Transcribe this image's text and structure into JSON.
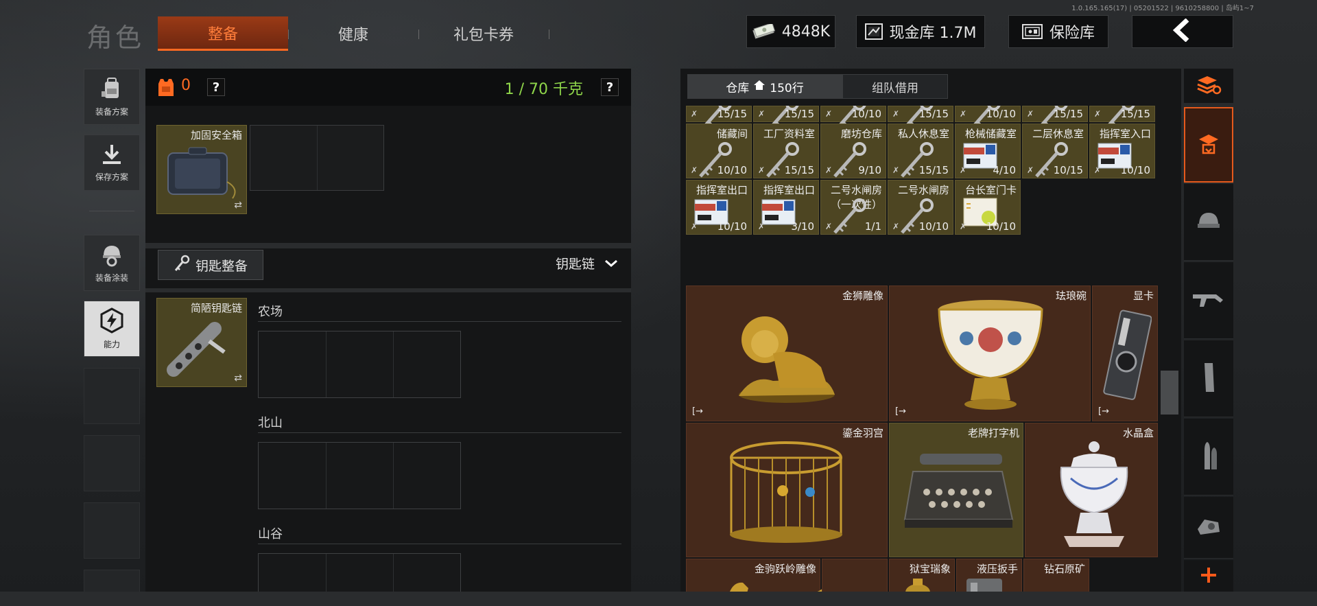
{
  "version": "1.0.165.165(17) | 05201522 | 9610258800 | 岛屿1~7",
  "header": {
    "title": "角色",
    "tabs": [
      {
        "label": "整备",
        "active": true
      },
      {
        "label": "健康",
        "active": false
      },
      {
        "label": "礼包卡券",
        "active": false
      }
    ],
    "currency": "4848K",
    "cash_vault": "现金库 1.7M",
    "safe": "保险库"
  },
  "sidebar": {
    "items": [
      {
        "label": "装备方案",
        "icon": "backpack-icon"
      },
      {
        "label": "保存方案",
        "icon": "download-icon"
      },
      {
        "label": "装备涂装",
        "icon": "helmet-icon"
      },
      {
        "label": "能力",
        "icon": "lightning-icon",
        "active": true
      }
    ]
  },
  "loadout": {
    "bag_count": "0",
    "weight": "1 / 70 千克",
    "safe_box": {
      "label": "加固安全箱"
    },
    "key_button": "钥匙整备",
    "key_dropdown": "钥匙链",
    "keychain": {
      "label": "简陋钥匙链"
    },
    "key_groups": [
      "农场",
      "北山",
      "山谷"
    ]
  },
  "storage": {
    "tabs": [
      {
        "label": "仓库",
        "sub": "150行",
        "active": true
      },
      {
        "label": "组队借用",
        "active": false
      }
    ],
    "key_row0": [
      {
        "count": "15/15"
      },
      {
        "count": "15/15"
      },
      {
        "count": "10/10"
      },
      {
        "count": "15/15"
      },
      {
        "count": "10/10"
      },
      {
        "count": "15/15"
      },
      {
        "count": "15/15"
      }
    ],
    "key_row1": [
      {
        "name": "储藏间",
        "count": "10/10"
      },
      {
        "name": "工厂资料室",
        "count": "15/15"
      },
      {
        "name": "磨坊仓库",
        "count": "9/10"
      },
      {
        "name": "私人休息室",
        "count": "15/15"
      },
      {
        "name": "枪械储藏室",
        "count": "4/10"
      },
      {
        "name": "二层休息室",
        "count": "10/15"
      },
      {
        "name": "指挥室入口",
        "count": "10/10"
      }
    ],
    "key_row2": [
      {
        "name": "指挥室出口",
        "count": "10/10"
      },
      {
        "name": "指挥室出口",
        "count": "3/10"
      },
      {
        "name": "二号水闸房\n（一次性）",
        "count": "1/1"
      },
      {
        "name": "二号水闸房",
        "count": "10/10"
      },
      {
        "name": "台长室门卡",
        "count": "10/10"
      }
    ],
    "valuables": [
      {
        "name": "金狮雕像"
      },
      {
        "name": "珐琅碗"
      },
      {
        "name": "显卡"
      },
      {
        "name": "鎏金羽宫"
      },
      {
        "name": "老牌打字机"
      },
      {
        "name": "水晶盒"
      },
      {
        "name": "金驹跃岭雕像"
      },
      {
        "name": "狱宝瑞象"
      },
      {
        "name": "液压扳手"
      },
      {
        "name": "钻石原矿"
      }
    ]
  },
  "categories": [
    "sort-icon",
    "key-stack-icon",
    "helmet-icon",
    "rifle-icon",
    "magazine-icon",
    "ammo-icon",
    "scope-icon",
    "add-icon"
  ],
  "colors": {
    "accent": "#ff6a22",
    "weight": "#8fd64a",
    "rare_yellow": "#4d4522",
    "rare_red": "#45291b"
  }
}
